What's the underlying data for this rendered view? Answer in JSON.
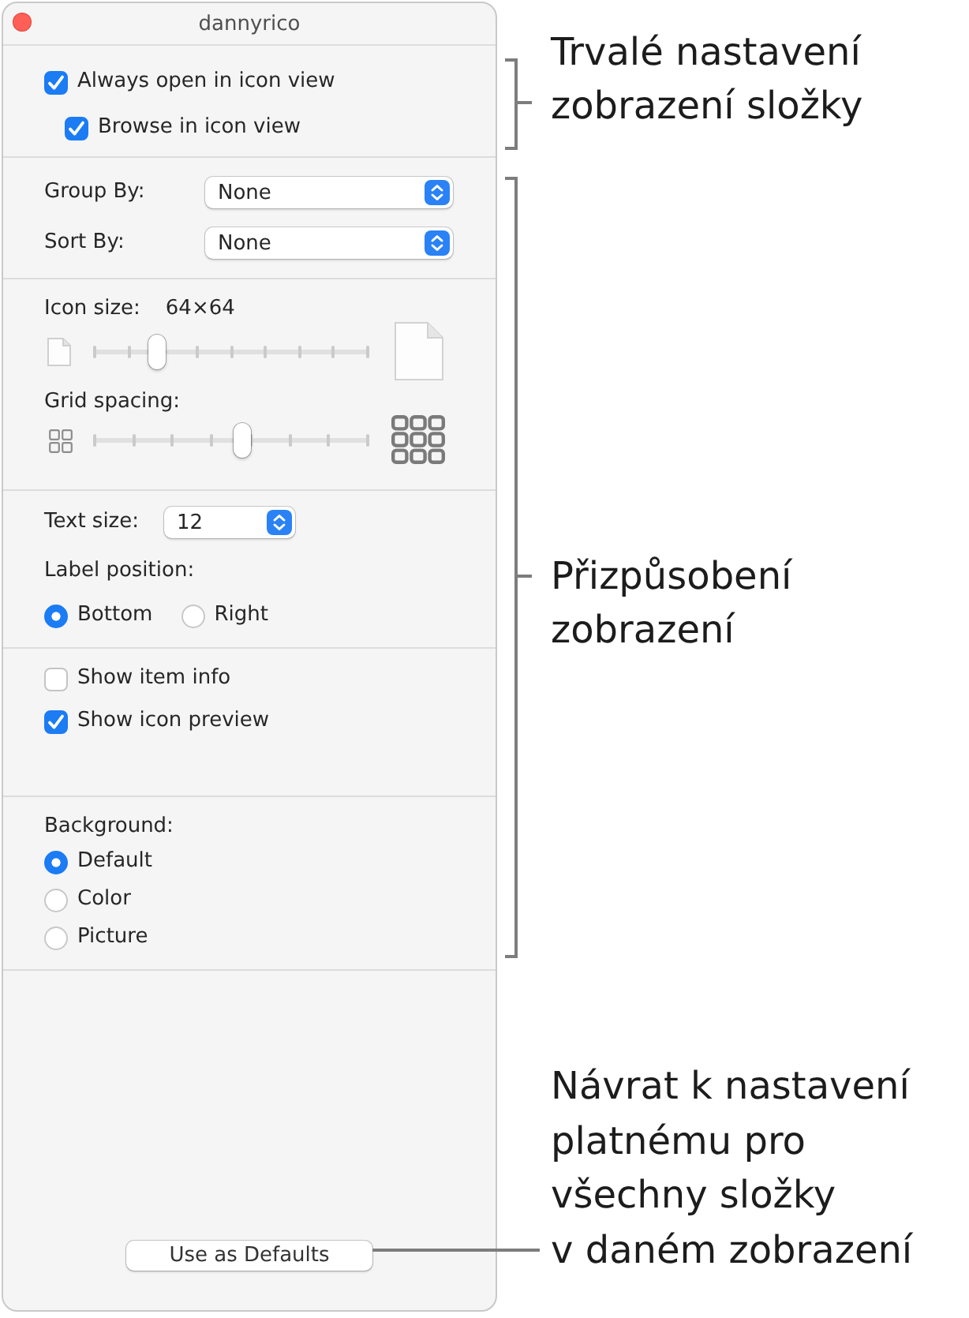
{
  "window": {
    "title": "dannyrico"
  },
  "view_options": [
    {
      "label": "Always open in icon view",
      "checked": true,
      "children": [
        {
          "label": "Browse in icon view",
          "checked": true
        }
      ]
    }
  ],
  "arrange": [
    {
      "label": "Group By:",
      "value": "None"
    },
    {
      "label": "Sort By:",
      "value": "None"
    }
  ],
  "sliders": [
    {
      "kind": "icon_size",
      "label": "Icon size:",
      "reading": "64×64",
      "level": 0.23
    },
    {
      "kind": "grid_spacing",
      "label": "Grid spacing:",
      "level": 0.54
    }
  ],
  "text_size": {
    "label": "Text size:",
    "value": "12"
  },
  "label_position": {
    "label": "Label position:",
    "options": [
      {
        "label": "Bottom",
        "selected": true
      },
      {
        "label": "Right",
        "selected": false
      }
    ]
  },
  "item_options": [
    {
      "label": "Show item info",
      "checked": false
    },
    {
      "label": "Show icon preview",
      "checked": true
    }
  ],
  "background": {
    "label": "Background:",
    "options": [
      {
        "label": "Default",
        "selected": true
      },
      {
        "label": "Color",
        "selected": false
      },
      {
        "label": "Picture",
        "selected": false
      }
    ]
  },
  "defaults_button": {
    "label": "Use as Defaults"
  },
  "callouts": [
    {
      "kind": "bracket",
      "text": "Trvalé nastavení\nzobrazení složky"
    },
    {
      "kind": "bracket",
      "text": "Přizpůsobení\nzobrazení"
    },
    {
      "kind": "leader",
      "text": "Návrat k nastavení\nplatnému pro\nvšechny složky\nv daném zobrazení"
    }
  ]
}
